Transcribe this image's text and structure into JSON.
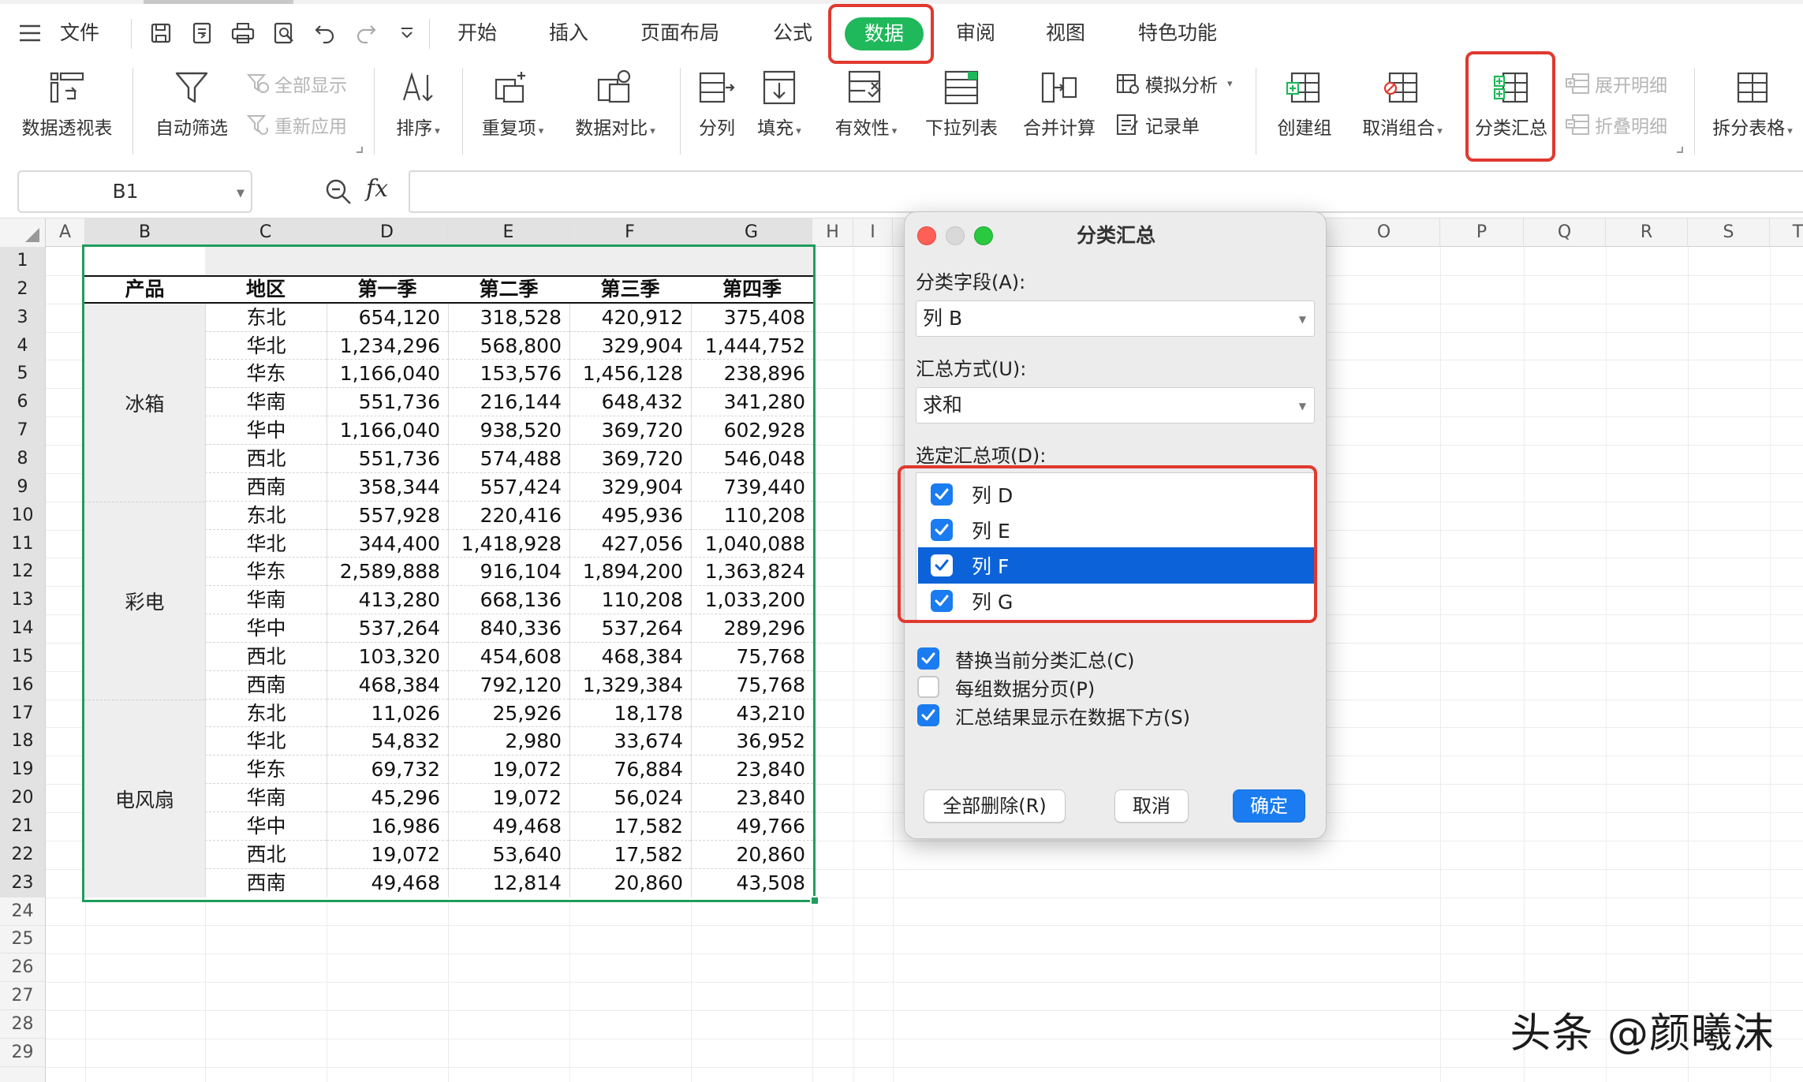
{
  "menubar": {
    "file_label": "文件",
    "tabs": [
      "开始",
      "插入",
      "页面布局",
      "公式",
      "数据",
      "审阅",
      "视图",
      "特色功能"
    ],
    "active_tab": "数据"
  },
  "ribbon": {
    "pivot": "数据透视表",
    "autofilter": "自动筛选",
    "show_all": "全部显示",
    "reapply": "重新应用",
    "sort": "排序",
    "duplicates": "重复项",
    "compare": "数据对比",
    "split": "分列",
    "fill": "填充",
    "validity": "有效性",
    "dropdown_list": "下拉列表",
    "consolidate": "合并计算",
    "whatif": "模拟分析",
    "record_form": "记录单",
    "group": "创建组",
    "ungroup": "取消组合",
    "subtotal": "分类汇总",
    "expand_detail": "展开明细",
    "collapse_detail": "折叠明细",
    "split_table": "拆分表格"
  },
  "formula_bar": {
    "cell_ref": "B1",
    "fx": "fx",
    "formula": ""
  },
  "sheet": {
    "columns": [
      "A",
      "B",
      "C",
      "D",
      "E",
      "F",
      "G",
      "H",
      "I",
      "O",
      "P",
      "Q",
      "R",
      "S",
      "T"
    ],
    "rows": [
      "1",
      "2",
      "3",
      "4",
      "5",
      "6",
      "7",
      "8",
      "9",
      "10",
      "11",
      "12",
      "13",
      "14",
      "15",
      "16",
      "17",
      "18",
      "19",
      "20",
      "21",
      "22",
      "23",
      "24",
      "25",
      "26",
      "27",
      "28",
      "29"
    ],
    "headers": [
      "产品",
      "地区",
      "第一季",
      "第二季",
      "第三季",
      "第四季"
    ],
    "products": [
      "冰箱",
      "彩电",
      "电风扇"
    ],
    "data": [
      [
        "东北",
        "654,120",
        "318,528",
        "420,912",
        "375,408"
      ],
      [
        "华北",
        "1,234,296",
        "568,800",
        "329,904",
        "1,444,752"
      ],
      [
        "华东",
        "1,166,040",
        "153,576",
        "1,456,128",
        "238,896"
      ],
      [
        "华南",
        "551,736",
        "216,144",
        "648,432",
        "341,280"
      ],
      [
        "华中",
        "1,166,040",
        "938,520",
        "369,720",
        "602,928"
      ],
      [
        "西北",
        "551,736",
        "574,488",
        "369,720",
        "546,048"
      ],
      [
        "西南",
        "358,344",
        "557,424",
        "329,904",
        "739,440"
      ],
      [
        "东北",
        "557,928",
        "220,416",
        "495,936",
        "110,208"
      ],
      [
        "华北",
        "344,400",
        "1,418,928",
        "427,056",
        "1,040,088"
      ],
      [
        "华东",
        "2,589,888",
        "916,104",
        "1,894,200",
        "1,363,824"
      ],
      [
        "华南",
        "413,280",
        "668,136",
        "110,208",
        "1,033,200"
      ],
      [
        "华中",
        "537,264",
        "840,336",
        "537,264",
        "289,296"
      ],
      [
        "西北",
        "103,320",
        "454,608",
        "468,384",
        "75,768"
      ],
      [
        "西南",
        "468,384",
        "792,120",
        "1,329,384",
        "75,768"
      ],
      [
        "东北",
        "11,026",
        "25,926",
        "18,178",
        "43,210"
      ],
      [
        "华北",
        "54,832",
        "2,980",
        "33,674",
        "36,952"
      ],
      [
        "华东",
        "69,732",
        "19,072",
        "76,884",
        "23,840"
      ],
      [
        "华南",
        "45,296",
        "19,072",
        "56,024",
        "23,840"
      ],
      [
        "华中",
        "16,986",
        "49,468",
        "17,582",
        "49,766"
      ],
      [
        "西北",
        "19,072",
        "53,640",
        "17,582",
        "20,860"
      ],
      [
        "西南",
        "49,468",
        "12,814",
        "20,860",
        "43,508"
      ]
    ]
  },
  "dialog": {
    "title": "分类汇总",
    "field_label": "分类字段(A):",
    "field_value": "列 B",
    "method_label": "汇总方式(U):",
    "method_value": "求和",
    "items_label": "选定汇总项(D):",
    "items": [
      {
        "label": "列 D",
        "checked": true
      },
      {
        "label": "列 E",
        "checked": true
      },
      {
        "label": "列 F",
        "checked": true,
        "selected": true
      },
      {
        "label": "列 G",
        "checked": true
      }
    ],
    "options": [
      {
        "label": "替换当前分类汇总(C)",
        "checked": true
      },
      {
        "label": "每组数据分页(P)",
        "checked": false
      },
      {
        "label": "汇总结果显示在数据下方(S)",
        "checked": true
      }
    ],
    "btn_remove_all": "全部删除(R)",
    "btn_cancel": "取消",
    "btn_ok": "确定"
  },
  "watermark": "头条 @颜曦沫",
  "colors": {
    "accent_green": "#1fb85a",
    "highlight_red": "#e0392f",
    "mac_blue": "#1a7cf0",
    "selection_border": "#1f9d5c"
  }
}
